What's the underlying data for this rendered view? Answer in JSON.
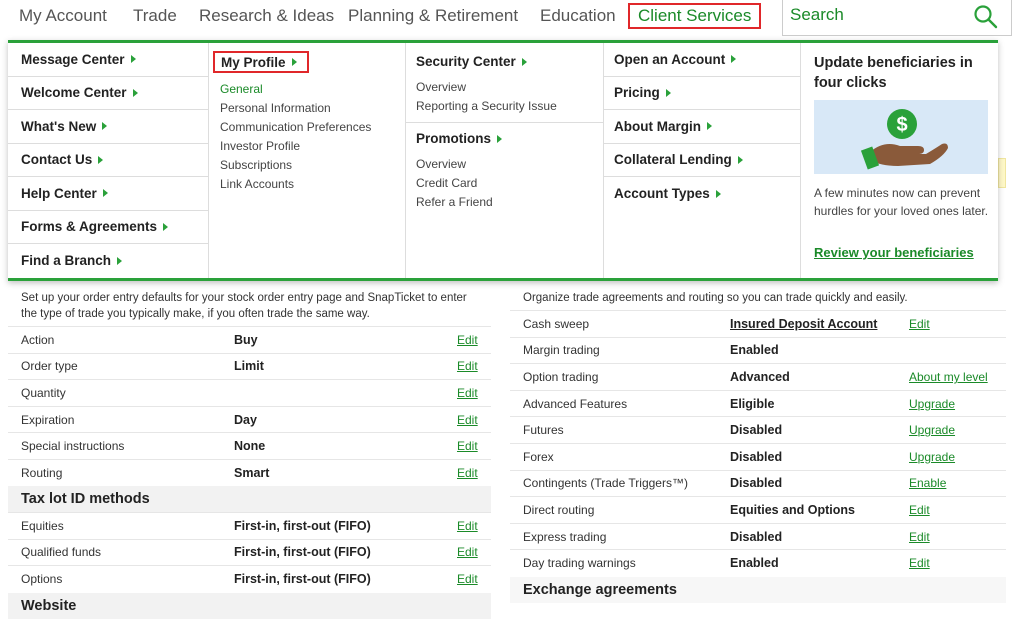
{
  "nav": {
    "items": [
      "My Account",
      "Trade",
      "Research & Ideas",
      "Planning & Retirement",
      "Education",
      "Client Services"
    ],
    "search_placeholder": "Search"
  },
  "menu": {
    "col1": [
      "Message Center",
      "Welcome Center",
      "What's New",
      "Contact Us",
      "Help Center",
      "Forms & Agreements",
      "Find a Branch"
    ],
    "my_profile": {
      "heading": "My Profile",
      "links": [
        "General",
        "Personal Information",
        "Communication Preferences",
        "Investor Profile",
        "Subscriptions",
        "Link Accounts"
      ]
    },
    "security": {
      "heading": "Security Center",
      "links": [
        "Overview",
        "Reporting a Security Issue"
      ]
    },
    "promotions": {
      "heading": "Promotions",
      "links": [
        "Overview",
        "Credit Card",
        "Refer a Friend"
      ]
    },
    "col4": [
      "Open an Account",
      "Pricing",
      "About Margin",
      "Collateral Lending",
      "Account Types"
    ],
    "promo": {
      "title": "Update beneficiaries in four clicks",
      "desc": "A few minutes now can prevent hurdles for your loved ones later.",
      "cta": "Review your beneficiaries"
    }
  },
  "left_panel": {
    "intro": "Set up your order entry defaults for your stock order entry page and SnapTicket to enter the type of trade you typically make, if you often trade the same way.",
    "rows": [
      {
        "label": "Action",
        "value": "Buy",
        "action": "Edit"
      },
      {
        "label": "Order type",
        "value": "Limit",
        "action": "Edit"
      },
      {
        "label": "Quantity",
        "value": "",
        "action": "Edit"
      },
      {
        "label": "Expiration",
        "value": "Day",
        "action": "Edit"
      },
      {
        "label": "Special instructions",
        "value": "None",
        "action": "Edit"
      },
      {
        "label": "Routing",
        "value": "Smart",
        "action": "Edit"
      }
    ],
    "taxlot_heading": "Tax lot ID methods",
    "taxlot_rows": [
      {
        "label": "Equities",
        "value": "First-in, first-out (FIFO)",
        "action": "Edit"
      },
      {
        "label": "Qualified funds",
        "value": "First-in, first-out (FIFO)",
        "action": "Edit"
      },
      {
        "label": "Options",
        "value": "First-in, first-out (FIFO)",
        "action": "Edit"
      }
    ],
    "website_heading": "Website"
  },
  "right_panel": {
    "intro": "Organize trade agreements and routing so you can trade quickly and easily.",
    "rows": [
      {
        "label": "Cash sweep",
        "value": "Insured Deposit Account",
        "action": "Edit"
      },
      {
        "label": "Margin trading",
        "value": "Enabled",
        "action": ""
      },
      {
        "label": "Option trading",
        "value": "Advanced",
        "action": "About my level"
      },
      {
        "label": "Advanced Features",
        "value": "Eligible",
        "action": "Upgrade"
      },
      {
        "label": "Futures",
        "value": "Disabled",
        "action": "Upgrade"
      },
      {
        "label": "Forex",
        "value": "Disabled",
        "action": "Upgrade"
      },
      {
        "label": "Contingents (Trade Triggers™)",
        "value": "Disabled",
        "action": "Enable"
      },
      {
        "label": "Direct routing",
        "value": "Equities and Options",
        "action": "Edit"
      },
      {
        "label": "Express trading",
        "value": "Disabled",
        "action": "Edit"
      },
      {
        "label": "Day trading warnings",
        "value": "Enabled",
        "action": "Edit"
      }
    ],
    "exchange_heading": "Exchange agreements"
  }
}
